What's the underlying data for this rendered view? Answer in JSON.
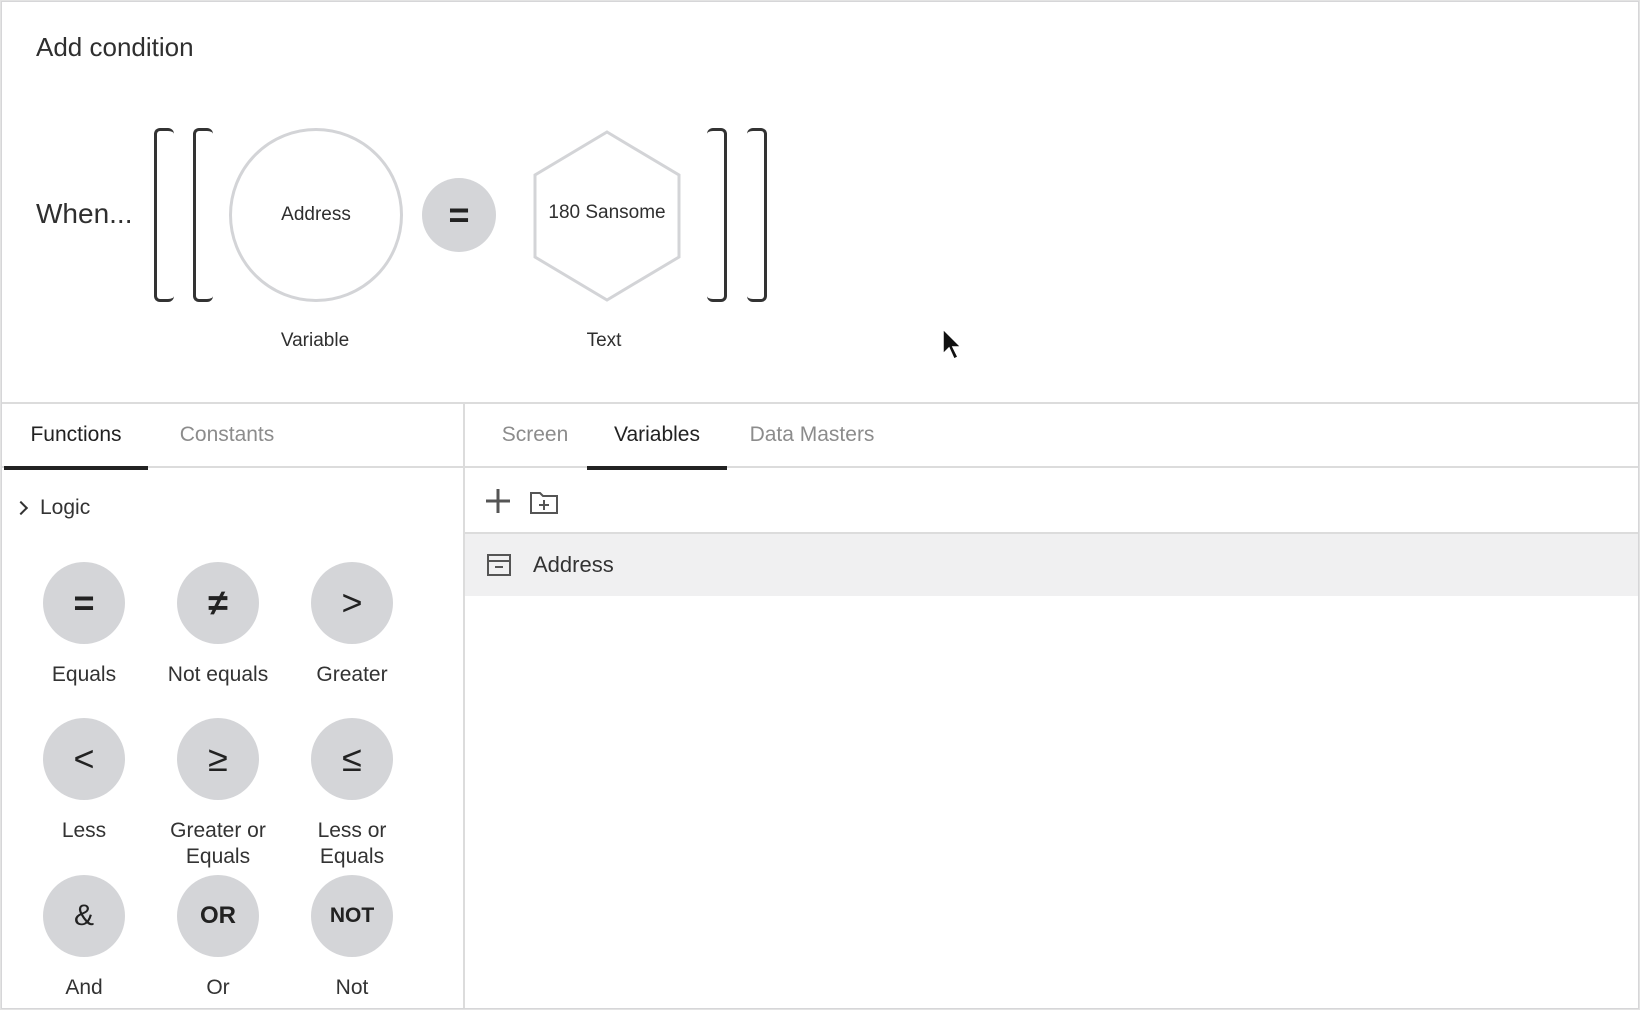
{
  "builder": {
    "title": "Add condition",
    "when_label": "When...",
    "left_operand": {
      "value": "Address",
      "type_label": "Variable"
    },
    "operator": {
      "symbol": "="
    },
    "right_operand": {
      "value": "180 Sansome",
      "type_label": "Text"
    }
  },
  "functions_panel": {
    "tabs": [
      {
        "label": "Functions",
        "active": true
      },
      {
        "label": "Constants",
        "active": false
      }
    ],
    "group": {
      "label": "Logic",
      "icon": "chevron-right-icon"
    },
    "items": [
      {
        "label": "Equals",
        "symbol": "="
      },
      {
        "label": "Not equals",
        "symbol": "≠"
      },
      {
        "label": "Greater",
        "symbol": ">"
      },
      {
        "label": "Less",
        "symbol": "<"
      },
      {
        "label": "Greater or Equals",
        "symbol": "≥"
      },
      {
        "label": "Less or Equals",
        "symbol": "≤"
      },
      {
        "label": "And",
        "symbol": "&"
      },
      {
        "label": "Or",
        "symbol": "OR"
      },
      {
        "label": "Not",
        "symbol": "NOT"
      }
    ]
  },
  "data_panel": {
    "tabs": [
      {
        "label": "Screen",
        "active": false
      },
      {
        "label": "Variables",
        "active": true
      },
      {
        "label": "Data Masters",
        "active": false
      }
    ],
    "toolbar": {
      "add_icon": "plus-icon",
      "add_folder_icon": "folder-plus-icon"
    },
    "variables": [
      {
        "name": "Address",
        "icon": "variable-box-icon"
      }
    ]
  },
  "colors": {
    "bubble": "#d4d5d8",
    "operand_outline": "#d3d4d7",
    "selected_row": "#f0f0f1",
    "active_tab": "#222222",
    "inactive_tab": "#8c8c8c"
  }
}
